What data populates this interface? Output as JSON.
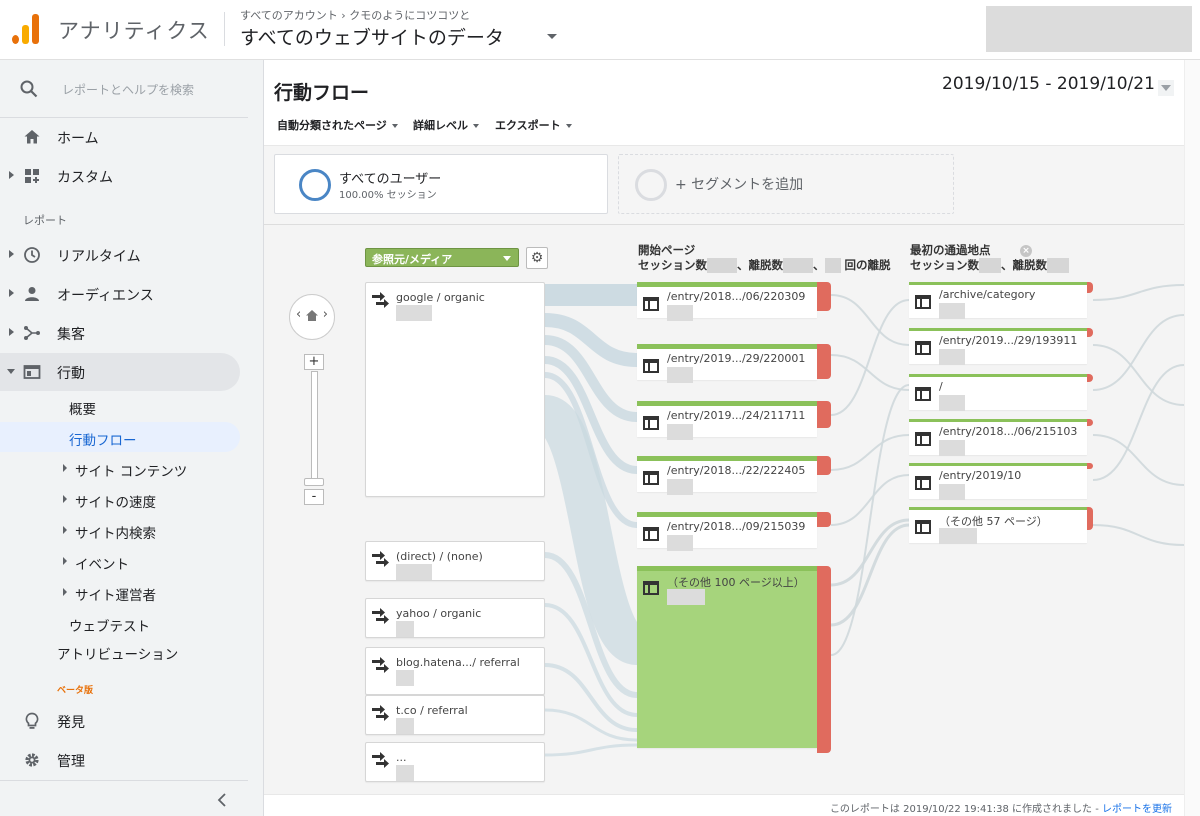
{
  "header": {
    "app_name": "アナリティクス",
    "breadcrumb_all": "すべてのアカウント",
    "breadcrumb_sep": "›",
    "breadcrumb_account": "クモのようにコツコツと",
    "property_view": "すべてのウェブサイトのデータ"
  },
  "sidebar": {
    "search_placeholder": "レポートとヘルプを検索",
    "home": "ホーム",
    "custom": "カスタム",
    "section_reports": "レポート",
    "realtime": "リアルタイム",
    "audience": "オーディエンス",
    "acquisition": "集客",
    "behavior": "行動",
    "sub": {
      "overview": "概要",
      "behavior_flow": "行動フロー",
      "site_content": "サイト コンテンツ",
      "site_speed": "サイトの速度",
      "site_search": "サイト内検索",
      "events": "イベント",
      "publisher": "サイト運営者",
      "experiments": "ウェブテスト"
    },
    "attribution": "アトリビューション",
    "beta": "ベータ版",
    "discover": "発見",
    "admin": "管理"
  },
  "main": {
    "title": "行動フロー",
    "date_range": "2019/10/15 - 2019/10/21",
    "toolbar": {
      "auto_pages": "自動分類されたページ",
      "detail_level": "詳細レベル",
      "export": "エクスポート"
    },
    "segment": {
      "name": "すべてのユーザー",
      "sub": "100.00% セッション",
      "add": "+ セグメントを追加"
    },
    "flow": {
      "dimension": "参照元/メディア",
      "zoom_in": "+",
      "zoom_out": "-",
      "nav_left": "‹",
      "nav_right": "›",
      "col_start": {
        "title": "開始ページ",
        "sessions": "セッション数",
        "sep": "、離脱数",
        "tail": "回の離脱"
      },
      "col_first": {
        "title": "最初の通過地点",
        "sessions": "セッション数",
        "sep": "、離脱数"
      },
      "sources": [
        {
          "name": "google / organic"
        },
        {
          "name": "(direct) / (none)"
        },
        {
          "name": "yahoo / organic"
        },
        {
          "name": "blog.hatena.../ referral"
        },
        {
          "name": "t.co / referral"
        },
        {
          "name": "..."
        }
      ],
      "start_pages": [
        {
          "path": "/entry/2018.../06/220309"
        },
        {
          "path": "/entry/2019.../29/220001"
        },
        {
          "path": "/entry/2019.../24/211711"
        },
        {
          "path": "/entry/2018.../22/222405"
        },
        {
          "path": "/entry/2018.../09/215039"
        },
        {
          "path": "（その他 100 ページ以上）"
        }
      ],
      "first_pages": [
        {
          "path": "/archive/category"
        },
        {
          "path": "/entry/2019.../29/193911"
        },
        {
          "path": "/"
        },
        {
          "path": "/entry/2018.../06/215103"
        },
        {
          "path": "/entry/2019/10"
        },
        {
          "path": "（その他 57 ページ）"
        }
      ]
    },
    "footer": {
      "text": "このレポートは 2019/10/22 19:41:38 に作成されました - ",
      "link": "レポートを更新"
    }
  },
  "colors": {
    "node_green": "#8bc15a",
    "drop_red": "#e06b5e",
    "segment_blue": "#4a86c5",
    "active_blue": "#1967d2"
  }
}
